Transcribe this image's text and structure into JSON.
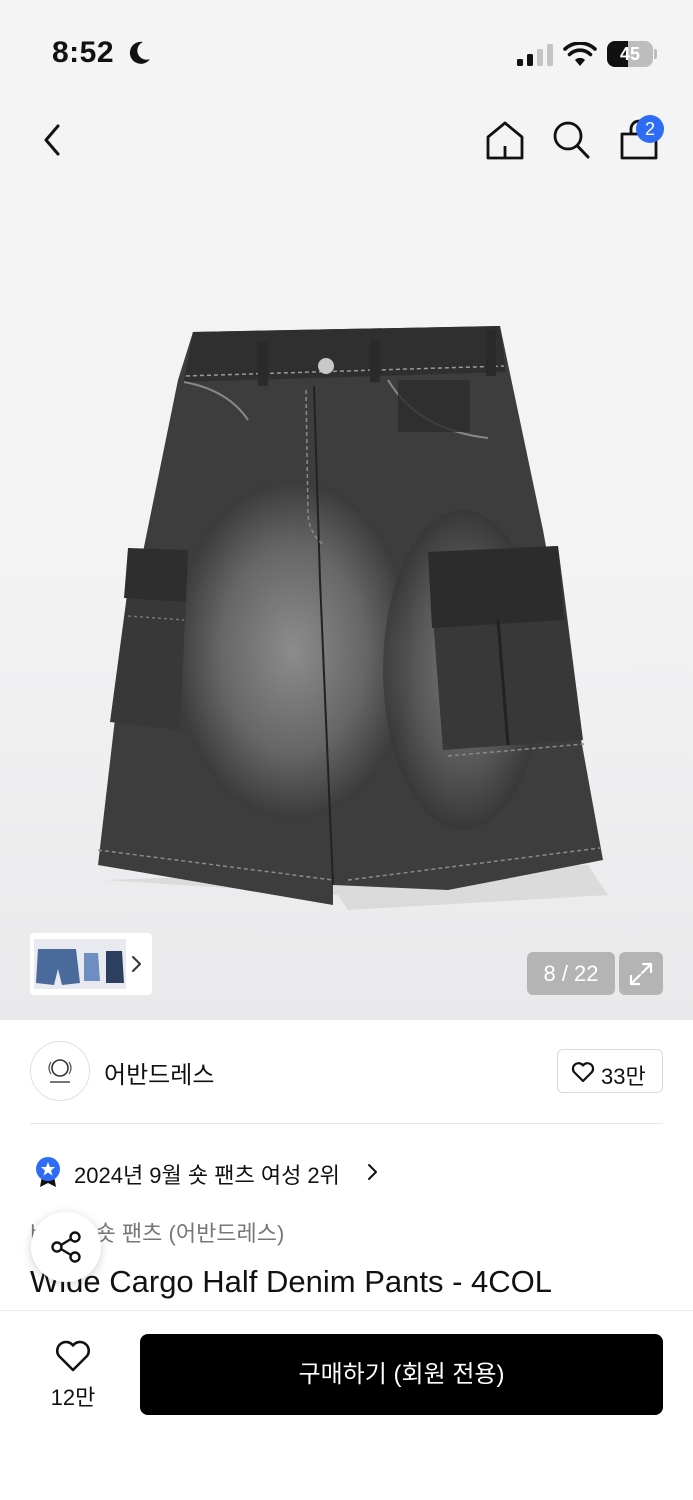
{
  "status_bar": {
    "time": "8:52",
    "battery_level": "45",
    "icons": [
      "moon-icon",
      "cellular-signal-icon",
      "wifi-icon",
      "battery-icon"
    ]
  },
  "nav": {
    "icons": [
      "back-chevron-icon",
      "home-icon",
      "search-icon",
      "shopping-bag-icon"
    ],
    "cart_count": "2"
  },
  "gallery": {
    "counter": "8 / 22",
    "current_index": 8,
    "total": 22,
    "icons": [
      "expand-icon",
      "chevron-right-icon"
    ]
  },
  "brand": {
    "name": "어반드레스",
    "likes": "33만"
  },
  "ranking": {
    "text": "2024년 9월 숏 팬츠 여성 2위"
  },
  "product": {
    "category": "바지 > 숏 팬츠 (어반드레스)",
    "title": "Wide Cargo Half Denim Pants - 4COL"
  },
  "bottom_bar": {
    "wish_count": "12만",
    "buy_label": "구매하기 (회원 전용)"
  },
  "colors": {
    "accent_blue": "#2f6cf6",
    "buy_button": "#000000",
    "background": "#ffffff"
  }
}
